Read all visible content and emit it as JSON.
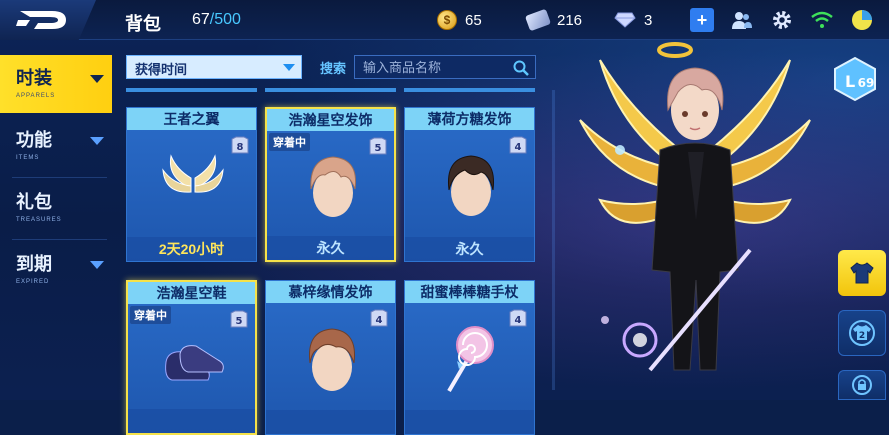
{
  "topbar": {
    "bag_title": "背包",
    "bag_used": "67",
    "bag_max": "/500",
    "coins": "65",
    "tickets": "216",
    "gems": "3"
  },
  "sidebar": {
    "items": [
      {
        "label": "时装",
        "sub": "APPARELS",
        "active": true
      },
      {
        "label": "功能",
        "sub": "ITEMS",
        "active": false
      },
      {
        "label": "礼包",
        "sub": "TREASURES",
        "active": false
      },
      {
        "label": "到期",
        "sub": "EXPIRED",
        "active": false
      }
    ]
  },
  "filter": {
    "sort_label": "获得时间",
    "search_label": "搜索",
    "search_placeholder": "输入商品名称"
  },
  "items": [
    {
      "name": "王者之翼",
      "level": "8",
      "worn": false,
      "footer": "2天20小时",
      "timed": true,
      "art": "wings-icon"
    },
    {
      "name": "浩瀚星空发饰",
      "level": "5",
      "worn": true,
      "worn_label": "穿着中",
      "footer": "永久",
      "timed": false,
      "art": "hair-icon"
    },
    {
      "name": "薄荷方糖发饰",
      "level": "4",
      "worn": false,
      "footer": "永久",
      "timed": false,
      "art": "hair-icon"
    },
    {
      "name": "浩瀚星空鞋",
      "level": "5",
      "worn": true,
      "worn_label": "穿着中",
      "footer": "",
      "timed": false,
      "art": "shoes-icon"
    },
    {
      "name": "慕梓缘情发饰",
      "level": "4",
      "worn": false,
      "footer": "",
      "timed": false,
      "art": "hair-icon"
    },
    {
      "name": "甜蜜棒棒糖手杖",
      "level": "4",
      "worn": false,
      "footer": "",
      "timed": false,
      "art": "lollipop-icon"
    }
  ],
  "character": {
    "level": "69",
    "level_prefix": "L"
  },
  "side_buttons": [
    {
      "icon": "shirt-icon",
      "active": true
    },
    {
      "icon": "shirt-2-icon",
      "label": "2",
      "active": false
    },
    {
      "icon": "lock-icon",
      "active": false
    }
  ],
  "colors": {
    "accent": "#ffe02a",
    "title_bar": "#7dd3f7",
    "card": "#2a6cc9",
    "timed": "#ffe55a"
  }
}
